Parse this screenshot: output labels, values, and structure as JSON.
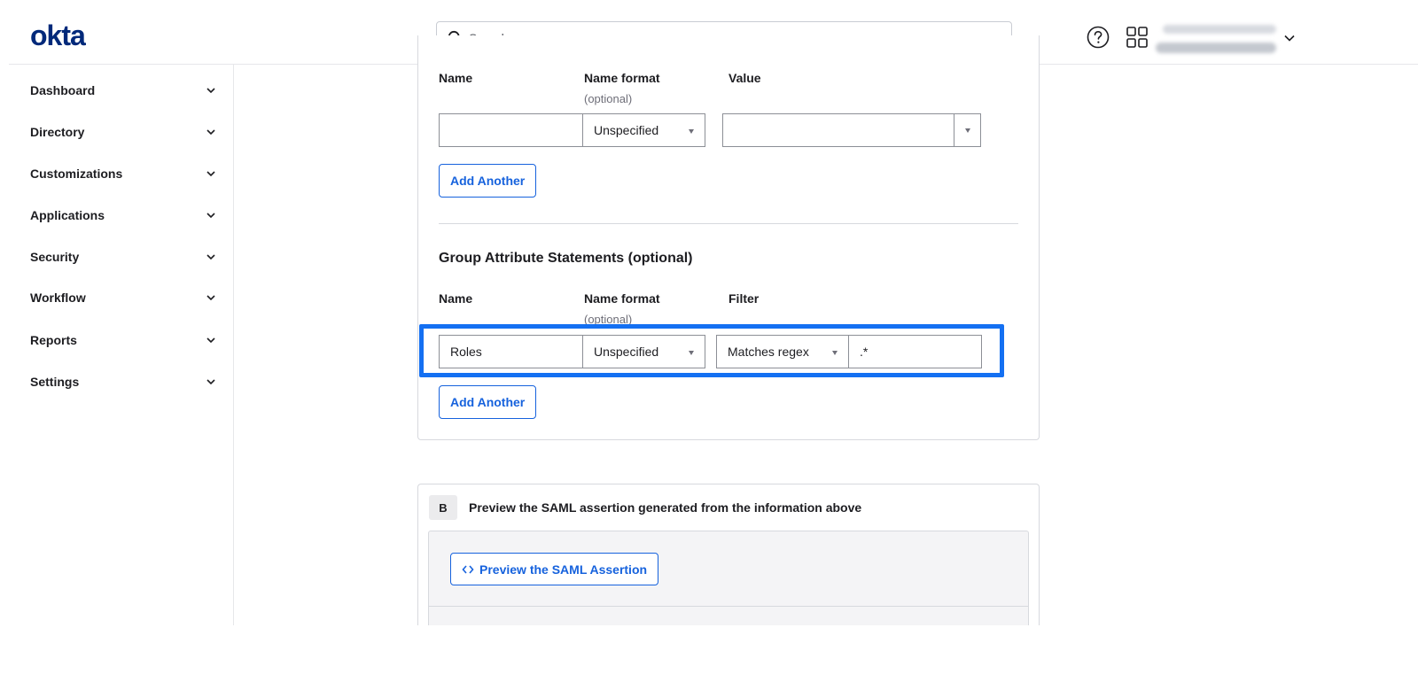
{
  "header": {
    "logo": "okta",
    "search": {
      "placeholder": "Search..."
    }
  },
  "sidebar": {
    "items": [
      {
        "label": "Dashboard"
      },
      {
        "label": "Directory"
      },
      {
        "label": "Customizations"
      },
      {
        "label": "Applications"
      },
      {
        "label": "Security"
      },
      {
        "label": "Workflow"
      },
      {
        "label": "Reports"
      },
      {
        "label": "Settings"
      }
    ]
  },
  "attribute_statements": {
    "columns": {
      "name": "Name",
      "name_format": "Name format",
      "name_format_sub": "(optional)",
      "value": "Value"
    },
    "row": {
      "name": "",
      "name_format": "Unspecified",
      "value": ""
    },
    "add_another_label": "Add Another"
  },
  "group_attribute_statements": {
    "title": "Group Attribute Statements (optional)",
    "columns": {
      "name": "Name",
      "name_format": "Name format",
      "name_format_sub": "(optional)",
      "filter": "Filter"
    },
    "row": {
      "name": "Roles",
      "name_format": "Unspecified",
      "filter_type": "Matches regex",
      "filter_value": ".*"
    },
    "add_another_label": "Add Another"
  },
  "preview_section": {
    "step": "B",
    "title": "Preview the SAML assertion generated from the information above",
    "button_label": "Preview the SAML Assertion"
  },
  "colors": {
    "accent": "#1662dd",
    "highlight": "#1470f2",
    "logo": "#00297a"
  }
}
